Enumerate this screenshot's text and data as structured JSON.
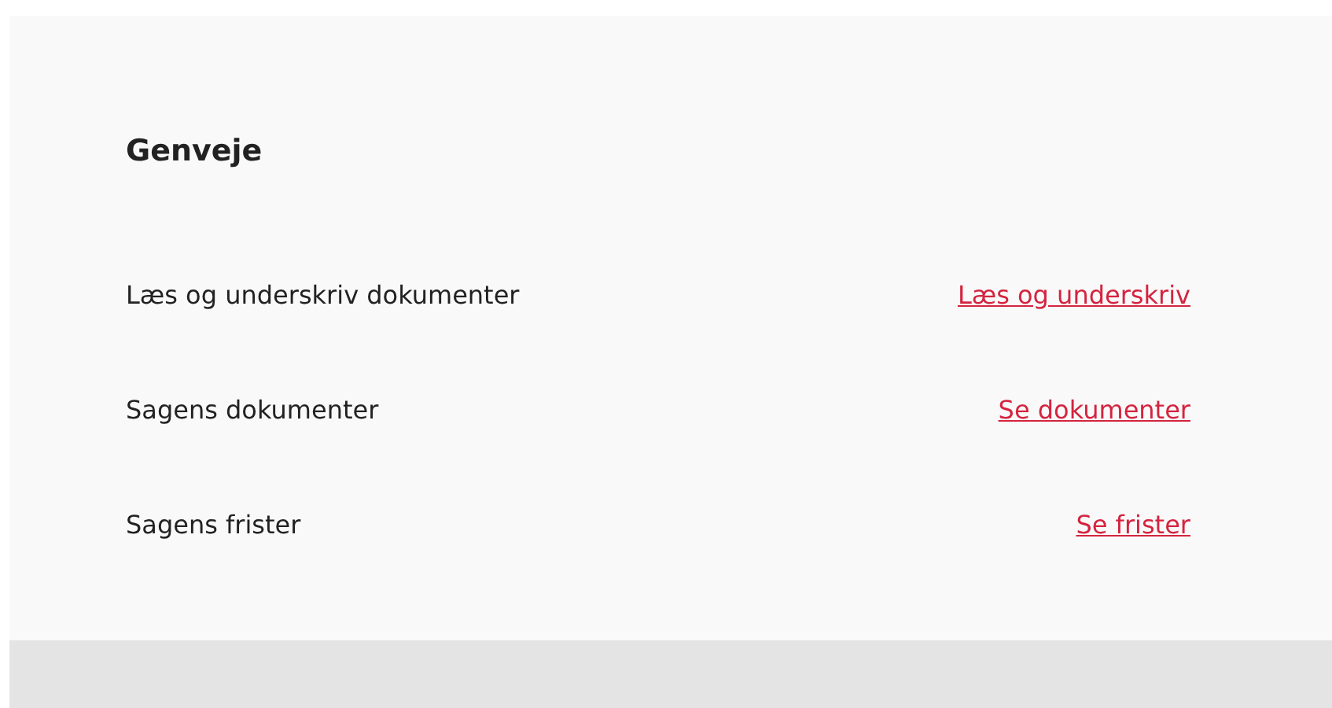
{
  "title": "Genveje",
  "rows": [
    {
      "label": "Læs og underskriv dokumenter",
      "link": "Læs og underskriv"
    },
    {
      "label": "Sagens dokumenter",
      "link": "Se dokumenter"
    },
    {
      "label": "Sagens frister",
      "link": "Se frister"
    }
  ]
}
